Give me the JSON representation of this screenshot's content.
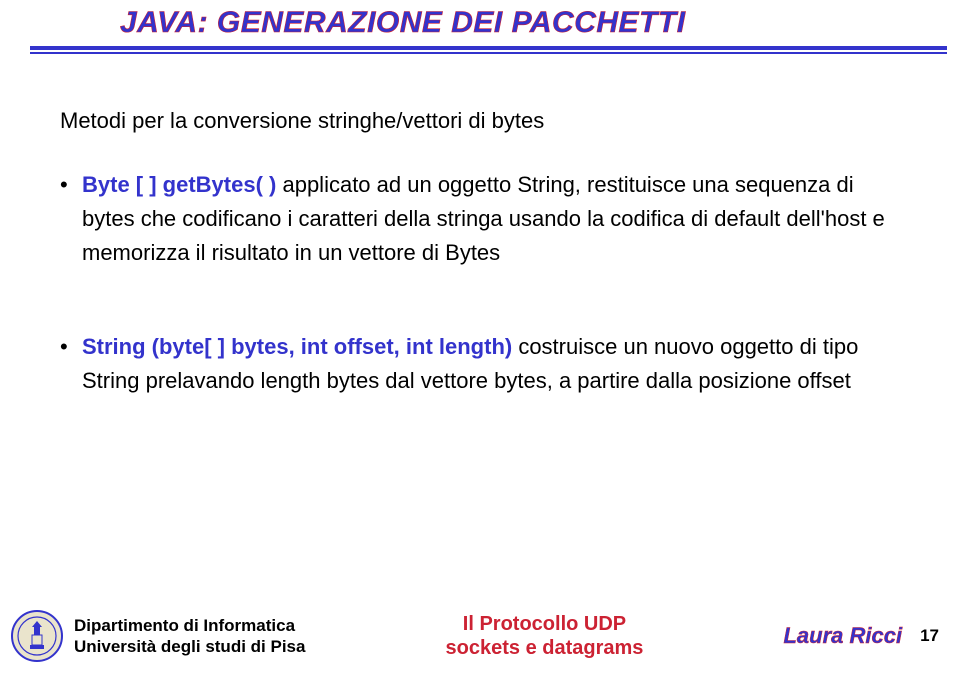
{
  "title": "JAVA: GENERAZIONE DEI PACCHETTI",
  "intro": "Metodi per la conversione stringhe/vettori di bytes",
  "bullets": [
    {
      "kw": "Byte [ ] getBytes( )",
      "rest": " applicato ad un oggetto String, restituisce una sequenza di bytes che codificano i caratteri della stringa usando la codifica di default dell'host e memorizza il risultato in un vettore di Bytes"
    },
    {
      "kw": "String (byte[ ] bytes, int offset, int length)",
      "rest": " costruisce un nuovo oggetto di tipo String prelavando length bytes dal vettore bytes, a partire dalla posizione offset"
    }
  ],
  "footer": {
    "dept_line1": "Dipartimento di Informatica",
    "dept_line2": "Università degli studi di Pisa",
    "center_line1": "Il Protocollo UDP",
    "center_line2": "sockets e datagrams",
    "author": "Laura Ricci",
    "page": "17"
  }
}
